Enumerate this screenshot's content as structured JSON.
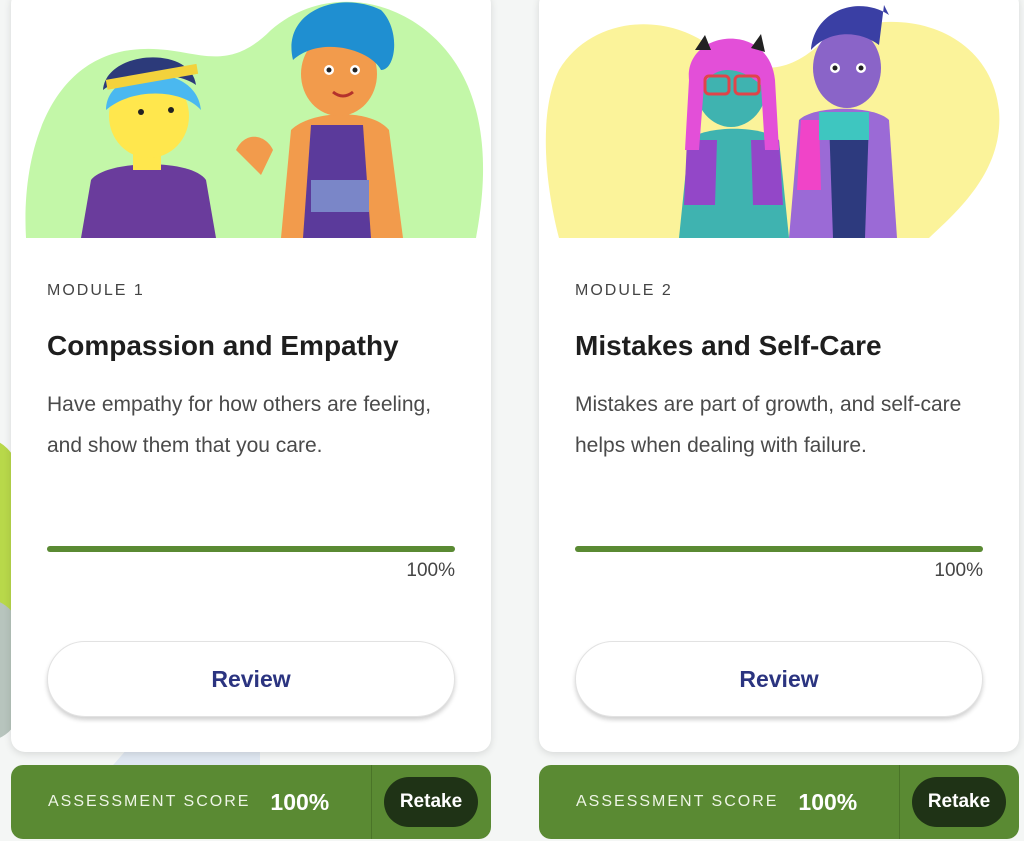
{
  "modules": [
    {
      "label": "MODULE 1",
      "title": "Compassion and Empathy",
      "description": "Have empathy for how others are feeling, and show them that you care.",
      "progress_percent": 100,
      "progress_text": "100%",
      "review_label": "Review",
      "illustration_bg_color": "#c3f7a8"
    },
    {
      "label": "MODULE 2",
      "title": "Mistakes and Self-Care",
      "description": "Mistakes are part of growth, and self-care helps when dealing with failure.",
      "progress_percent": 100,
      "progress_text": "100%",
      "review_label": "Review",
      "illustration_bg_color": "#fbf39a"
    }
  ],
  "assessments": [
    {
      "label": "ASSESSMENT SCORE",
      "score": "100%",
      "retake_label": "Retake"
    },
    {
      "label": "ASSESSMENT SCORE",
      "score": "100%",
      "retake_label": "Retake"
    }
  ],
  "colors": {
    "accent_green": "#5a8a33",
    "retake_dark": "#1f3316",
    "review_text": "#2b3480"
  }
}
